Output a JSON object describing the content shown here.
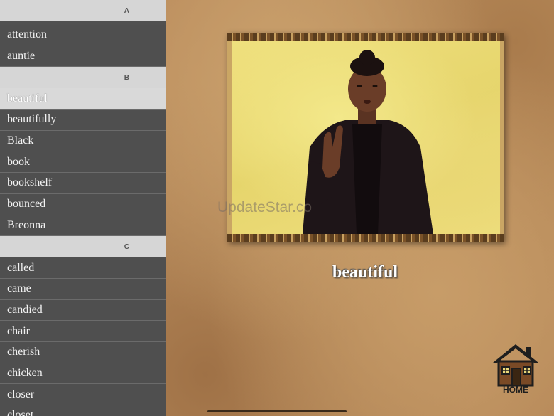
{
  "sidebar": {
    "sections": [
      {
        "letter": "A",
        "words": [
          "attention",
          "auntie"
        ]
      },
      {
        "letter": "B",
        "words": [
          "beautiful",
          "beautifully",
          "Black",
          "book",
          "bookshelf",
          "bounced",
          "Breonna"
        ]
      },
      {
        "letter": "C",
        "words": [
          "called",
          "came",
          "candied",
          "chair",
          "cherish",
          "chicken",
          "closer",
          "closet"
        ]
      }
    ],
    "selected_word": "beautiful"
  },
  "main": {
    "watermark": "UpdateStar.co",
    "current_word": "beautiful",
    "home_label": "HOME"
  },
  "icons": {
    "home": "home-icon"
  },
  "colors": {
    "sidebar_bg": "#505050",
    "section_header_bg": "#d6d6d6",
    "selected_row_bg": "#d9d9d9",
    "video_bg": "#ebdc78"
  }
}
